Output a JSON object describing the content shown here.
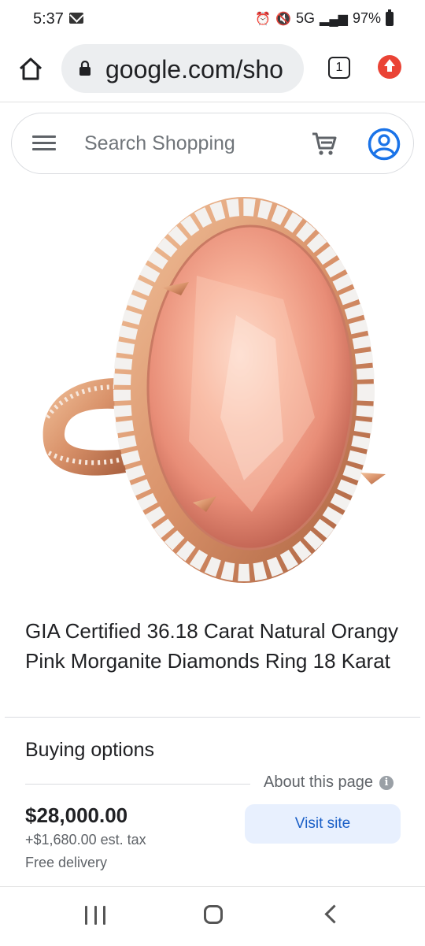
{
  "status": {
    "time": "5:37",
    "network": "5G",
    "battery": "97%"
  },
  "browser": {
    "url": "google.com/sho",
    "tab_count": "1"
  },
  "search": {
    "placeholder": "Search Shopping"
  },
  "product": {
    "title": "GIA Certified 36.18 Carat Natural Orangy Pink Morganite Diamonds Ring 18 Karat"
  },
  "buying": {
    "heading": "Buying options",
    "about_label": "About this page",
    "price": "$28,000.00",
    "tax": "+$1,680.00 est. tax",
    "delivery": "Free delivery",
    "visit_label": "Visit site"
  },
  "colors": {
    "accent": "#1a73e8",
    "update_badge": "#ea4335",
    "visit_button_bg": "#e8f0fe"
  },
  "icons": [
    "mail-icon",
    "alarm-icon",
    "mute-icon",
    "signal-icon",
    "battery-icon",
    "home-icon",
    "lock-icon",
    "tabs-icon",
    "update-icon",
    "menu-icon",
    "cart-icon",
    "account-icon",
    "info-icon"
  ]
}
